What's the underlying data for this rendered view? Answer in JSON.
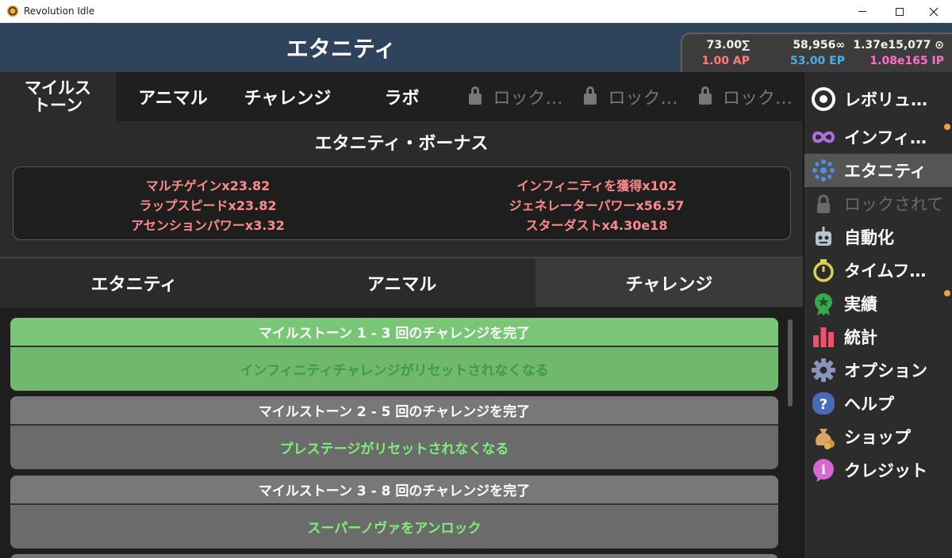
{
  "window": {
    "title": "Revolution Idle"
  },
  "header": {
    "title": "エタニティ",
    "stats": {
      "row1": [
        "73.00∑",
        "58,956∞",
        "1.37e15,077 ⊙"
      ],
      "row2": [
        "1.00 AP",
        "53.00 EP",
        "1.08e165 IP"
      ]
    },
    "colors": {
      "ap": "#ff7a7a",
      "ep": "#4aaee8",
      "ip": "#ff6fc8"
    }
  },
  "top_tabs": [
    {
      "label": "マイルス\nトーン",
      "active": true
    },
    {
      "label": "アニマル"
    },
    {
      "label": "チャレンジ"
    },
    {
      "label": "ラボ"
    },
    {
      "label": "ロック…",
      "locked": true
    },
    {
      "label": "ロック…",
      "locked": true
    },
    {
      "label": "ロック…",
      "locked": true
    }
  ],
  "bonus": {
    "title": "エタニティ・ボーナス",
    "left": [
      "マルチゲインx23.82",
      "ラップスピードx23.82",
      "アセンションパワーx3.32"
    ],
    "right": [
      "インフィニティを獲得x102",
      "ジェネレーターパワーx56.57",
      "スターダストx4.30e18"
    ]
  },
  "sub_tabs": [
    {
      "label": "エタニティ"
    },
    {
      "label": "アニマル"
    },
    {
      "label": "チャレンジ",
      "active": true
    }
  ],
  "milestones": [
    {
      "title": "マイルストーン 1 - 3 回のチャレンジを完了",
      "reward": "インフィニティチャレンジがリセットされなくなる",
      "completed": true
    },
    {
      "title": "マイルストーン 2 - 5 回のチャレンジを完了",
      "reward": "プレステージがリセットされなくなる",
      "completed": false
    },
    {
      "title": "マイルストーン 3 - 8 回のチャレンジを完了",
      "reward": "スーパーノヴァをアンロック",
      "completed": false
    }
  ],
  "sidebar": {
    "items": [
      {
        "label": "レボリュ…",
        "icon": "revolution-icon"
      },
      {
        "label": "インフィ…",
        "icon": "infinity-icon",
        "notify": true
      },
      {
        "label": "エタニティ",
        "icon": "eternity-icon",
        "active": true
      },
      {
        "label": "ロックされて",
        "icon": "lock-icon",
        "disabled": true
      },
      {
        "label": "自動化",
        "icon": "robot-icon"
      },
      {
        "label": "タイムフ…",
        "icon": "stopwatch-icon"
      },
      {
        "label": "実績",
        "icon": "medal-icon",
        "notify": true
      },
      {
        "label": "統計",
        "icon": "bar-chart-icon"
      },
      {
        "label": "オプション",
        "icon": "gear-icon"
      },
      {
        "label": "ヘルプ",
        "icon": "help-icon"
      },
      {
        "label": "ショップ",
        "icon": "money-bag-icon"
      },
      {
        "label": "クレジット",
        "icon": "info-icon"
      }
    ]
  }
}
